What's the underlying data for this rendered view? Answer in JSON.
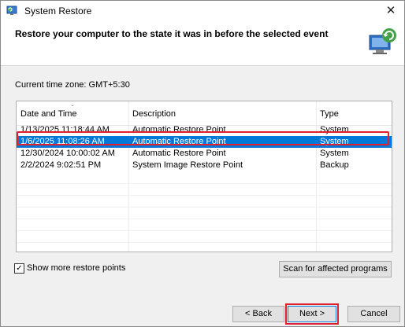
{
  "window": {
    "title": "System Restore"
  },
  "header": {
    "title": "Restore your computer to the state it was in before the selected event"
  },
  "timezone_label": "Current time zone: GMT+5:30",
  "table": {
    "columns": [
      "Date and Time",
      "Description",
      "Type"
    ],
    "rows": [
      [
        "1/13/2025 11:18:44 AM",
        "Automatic Restore Point",
        "System"
      ],
      [
        "1/6/2025 11:08:26 AM",
        "Automatic Restore Point",
        "System"
      ],
      [
        "12/30/2024 10:00:02 AM",
        "Automatic Restore Point",
        "System"
      ],
      [
        "2/2/2024 9:02:51 PM",
        "System Image Restore Point",
        "Backup"
      ]
    ],
    "selected_row": 1
  },
  "options": {
    "show_more_label": "Show more restore points",
    "show_more_checked": true,
    "check_glyph": "✓",
    "scan_label": "Scan for affected programs"
  },
  "buttons": {
    "back": "< Back",
    "next": "Next >",
    "cancel": "Cancel"
  },
  "icons": {
    "close_glyph": "✕"
  },
  "colors": {
    "selection": "#0078d7",
    "highlight": "#e0202f"
  }
}
